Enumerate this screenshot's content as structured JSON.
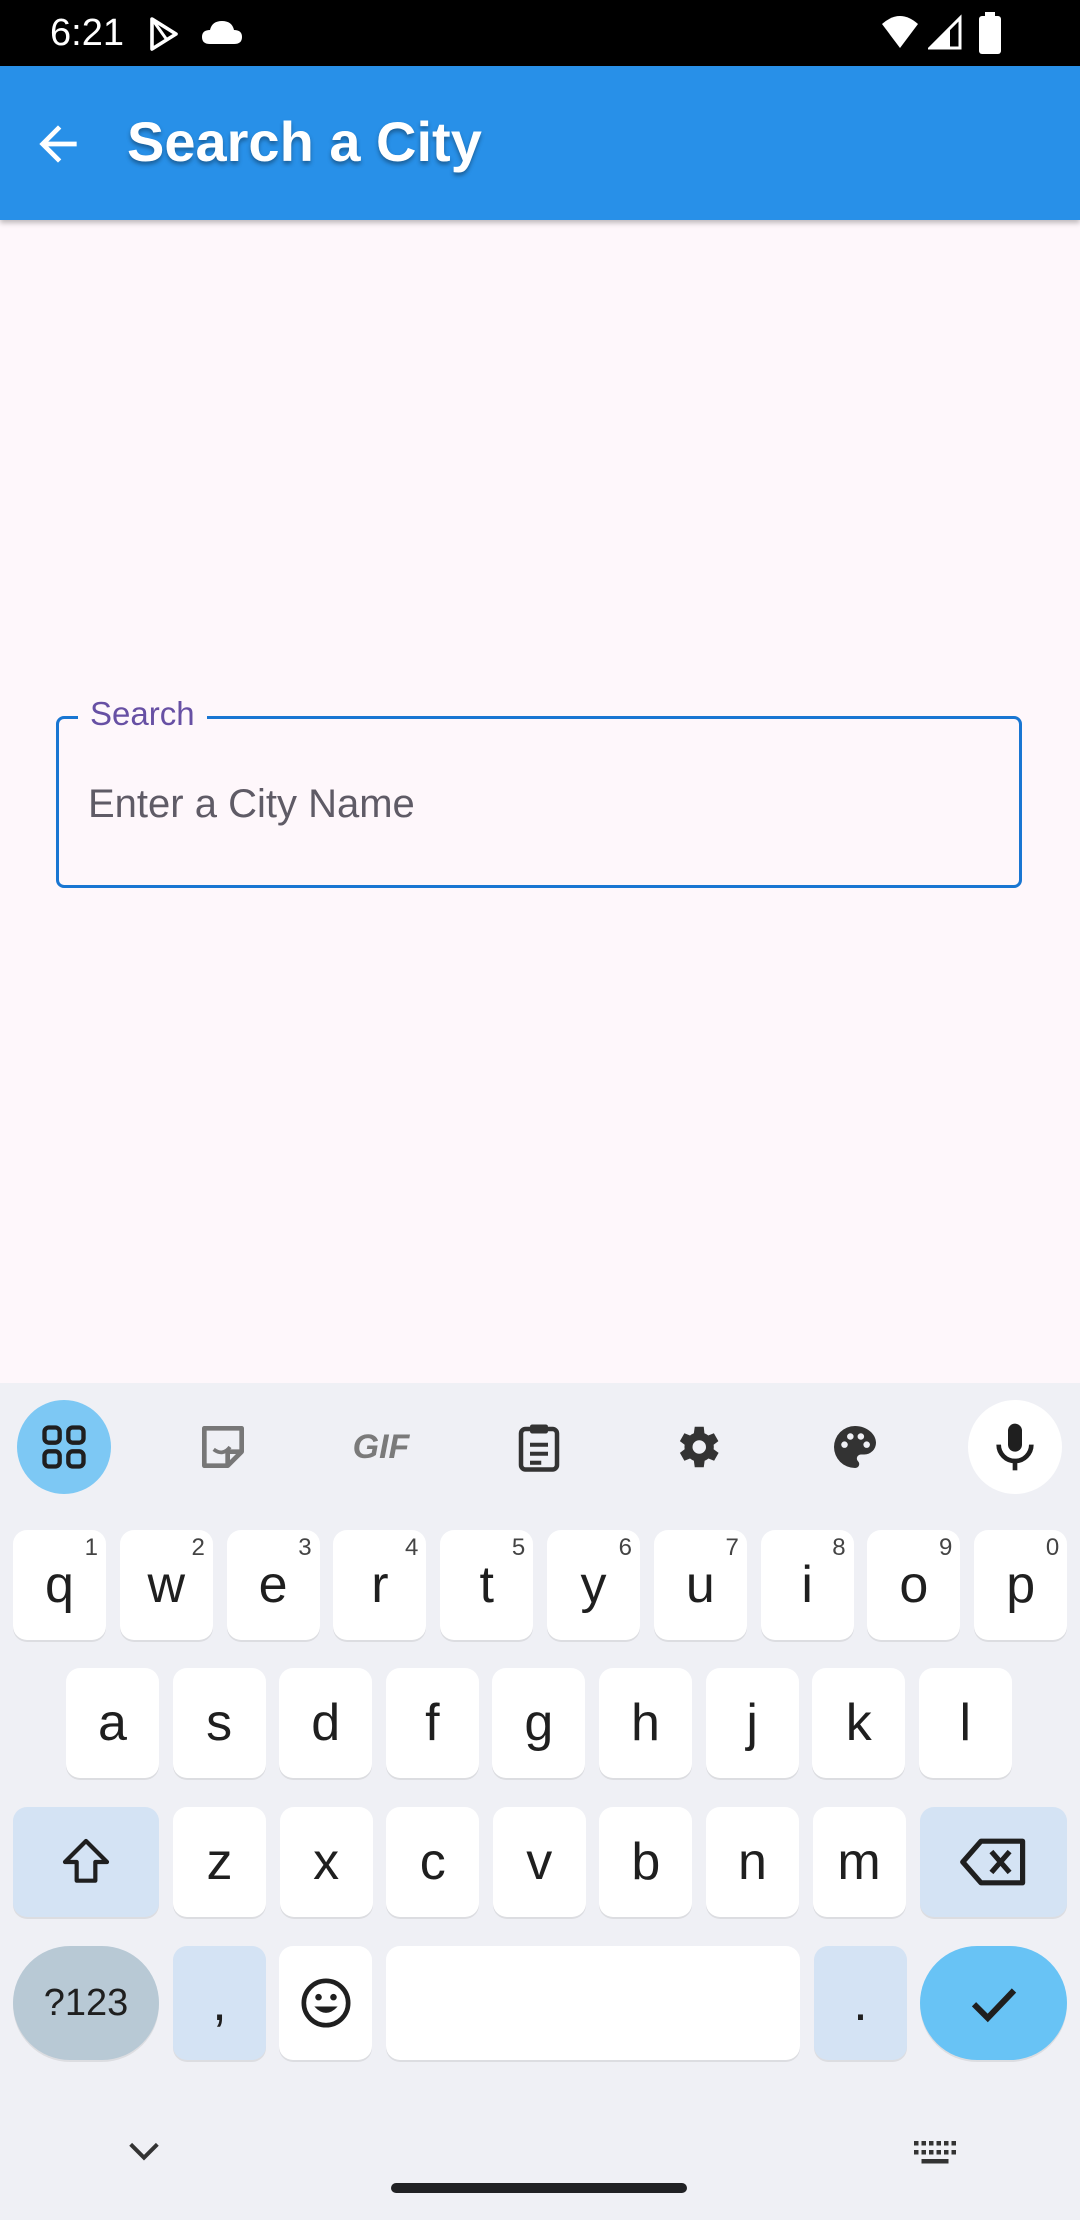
{
  "status": {
    "time": "6:21"
  },
  "appbar": {
    "title": "Search a City"
  },
  "search": {
    "label": "Search",
    "placeholder": "Enter a City Name"
  },
  "keyboard": {
    "row1": [
      {
        "key": "q",
        "hint": "1"
      },
      {
        "key": "w",
        "hint": "2"
      },
      {
        "key": "e",
        "hint": "3"
      },
      {
        "key": "r",
        "hint": "4"
      },
      {
        "key": "t",
        "hint": "5"
      },
      {
        "key": "y",
        "hint": "6"
      },
      {
        "key": "u",
        "hint": "7"
      },
      {
        "key": "i",
        "hint": "8"
      },
      {
        "key": "o",
        "hint": "9"
      },
      {
        "key": "p",
        "hint": "0"
      }
    ],
    "row2": [
      "a",
      "s",
      "d",
      "f",
      "g",
      "h",
      "j",
      "k",
      "l"
    ],
    "row3": [
      "z",
      "x",
      "c",
      "v",
      "b",
      "n",
      "m"
    ],
    "symbols_label": "?123",
    "comma": ",",
    "period": ".",
    "toolbar": [
      "apps-icon",
      "sticker-icon",
      "gif-icon",
      "clipboard-icon",
      "settings-icon",
      "palette-icon",
      "mic-icon"
    ],
    "gif_label": "GIF"
  }
}
